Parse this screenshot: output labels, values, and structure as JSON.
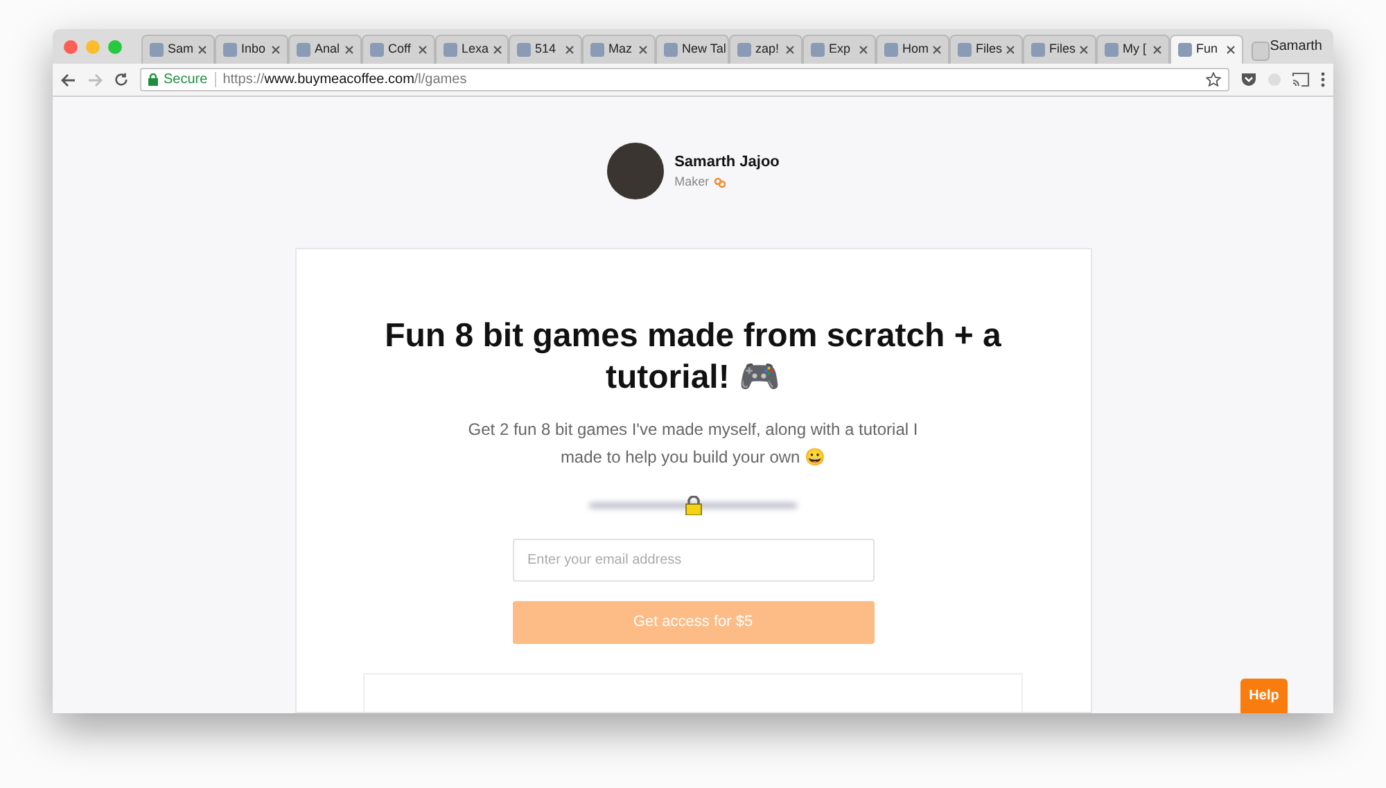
{
  "browser": {
    "tabs": [
      {
        "label": "Sam",
        "selected": false
      },
      {
        "label": "Inbo",
        "selected": false
      },
      {
        "label": "Anal",
        "selected": false
      },
      {
        "label": "Coff",
        "selected": false
      },
      {
        "label": "Lexa",
        "selected": false
      },
      {
        "label": "514",
        "selected": false
      },
      {
        "label": "Maz",
        "selected": false
      },
      {
        "label": "New Tal",
        "selected": false
      },
      {
        "label": "zap!",
        "selected": false
      },
      {
        "label": "Exp",
        "selected": false
      },
      {
        "label": "Hom",
        "selected": false
      },
      {
        "label": "Files",
        "selected": false
      },
      {
        "label": "Files",
        "selected": false
      },
      {
        "label": "My [",
        "selected": false
      },
      {
        "label": "Fun",
        "selected": true
      }
    ],
    "profile": "Samarth",
    "secure_label": "Secure",
    "url_scheme": "https://",
    "url_host": "www.buymeacoffee.com",
    "url_path": "/l/games"
  },
  "creator": {
    "name": "Samarth Jajoo",
    "role": "Maker"
  },
  "offer": {
    "title": "Fun 8 bit games made from scratch + a tutorial! 🎮",
    "description": "Get 2 fun 8 bit games I've made myself, along with a tutorial I made to help you build your own 😀",
    "email": {
      "placeholder": "Enter your email address"
    },
    "button": "Get access for $5"
  },
  "help": "Help"
}
